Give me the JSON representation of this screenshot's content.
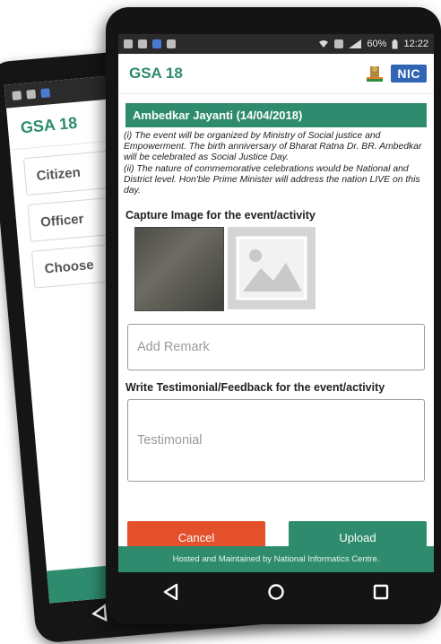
{
  "back_phone": {
    "app_title": "GSA 18",
    "menu_items": [
      "Citizen",
      "Officer",
      "Choose"
    ]
  },
  "front_phone": {
    "app_title": "GSA 18",
    "logo_text": "NIC",
    "status_time": "12:22",
    "status_battery": "60%",
    "event": {
      "title": "Ambedkar Jayanti (14/04/2018)",
      "description_1": "(i) The event will be organized by Ministry of Social justice and Empowerment. The birth anniversary of Bharat Ratna Dr. BR. Ambedkar will be celebrated as Social Justice Day.",
      "description_2": "(ii) The nature of commemorative celebrations would be National and District level. Hon'ble Prime Minister will address the nation LIVE on this day."
    },
    "capture_label": "Capture Image for the event/activity",
    "remark_placeholder": "Add Remark",
    "testimonial_label": "Write Testimonial/Feedback for the event/activity",
    "testimonial_placeholder": "Testimonial",
    "cancel_label": "Cancel",
    "upload_label": "Upload",
    "footer_text": "Hosted and Maintained by National Informatics Centre."
  },
  "colors": {
    "accent": "#2e8b6e",
    "cancel": "#e4502b",
    "nic_blue": "#2f65b3"
  },
  "icons": [
    "back-icon",
    "home-icon",
    "recents-icon",
    "image-placeholder-icon",
    "wifi-icon",
    "signal-icon",
    "battery-icon",
    "emblem-icon"
  ]
}
